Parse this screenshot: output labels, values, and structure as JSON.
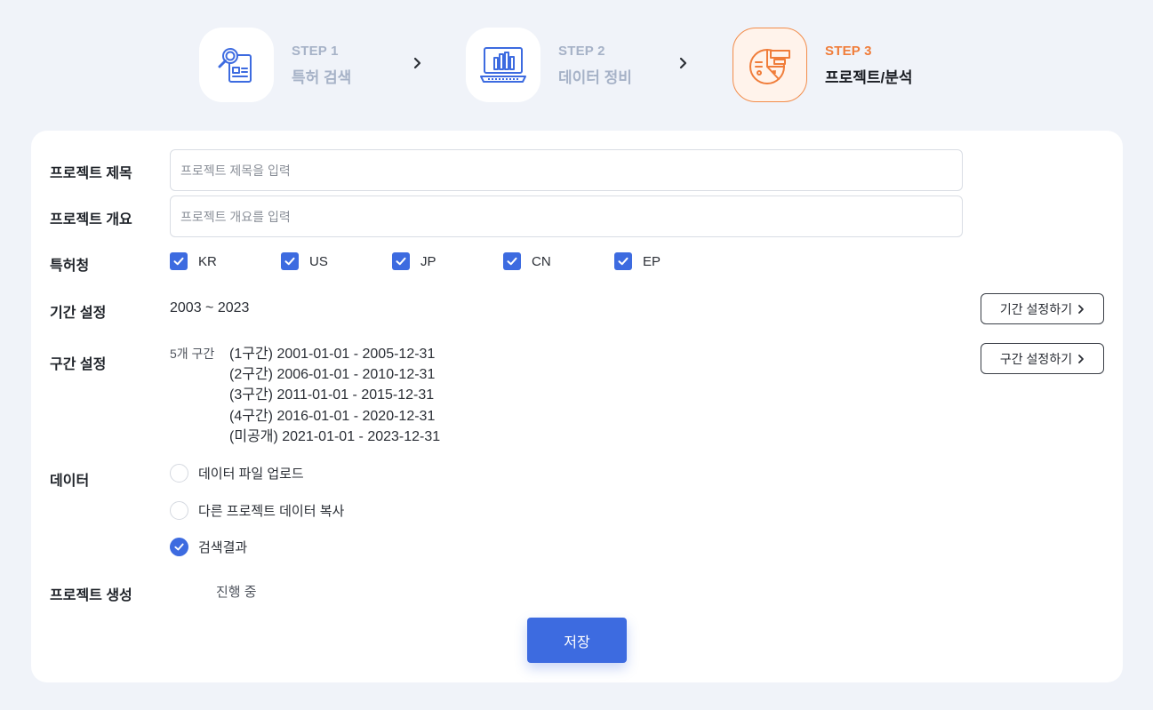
{
  "steps": [
    {
      "num": "STEP 1",
      "name": "특허 검색",
      "icon": "patent-search-icon",
      "active": false
    },
    {
      "num": "STEP 2",
      "name": "데이터 정비",
      "icon": "data-chart-monitor-icon",
      "active": false
    },
    {
      "num": "STEP 3",
      "name": "프로젝트/분석",
      "icon": "pie-chart-analysis-icon",
      "active": true
    }
  ],
  "form": {
    "title": {
      "label": "프로젝트 제목",
      "placeholder": "프로젝트 제목을 입력",
      "value": ""
    },
    "summary": {
      "label": "프로젝트 개요",
      "placeholder": "프로젝트 개요를 입력",
      "value": ""
    },
    "offices": {
      "label": "특허청",
      "items": [
        {
          "label": "KR",
          "checked": true
        },
        {
          "label": "US",
          "checked": true
        },
        {
          "label": "JP",
          "checked": true
        },
        {
          "label": "CN",
          "checked": true
        },
        {
          "label": "EP",
          "checked": true
        }
      ]
    },
    "period": {
      "label": "기간 설정",
      "value": "2003 ~ 2023",
      "button": "기간 설정하기"
    },
    "sections": {
      "label": "구간 설정",
      "count": "5개 구간",
      "items": [
        "(1구간) 2001-01-01 - 2005-12-31",
        "(2구간) 2006-01-01 - 2010-12-31",
        "(3구간) 2011-01-01 - 2015-12-31",
        "(4구간) 2016-01-01 - 2020-12-31",
        "(미공개) 2021-01-01 - 2023-12-31"
      ],
      "button": "구간 설정하기"
    },
    "data": {
      "label": "데이터",
      "options": [
        {
          "label": "데이터 파일 업로드",
          "checked": false
        },
        {
          "label": "다른 프로젝트 데이터 복사",
          "checked": false
        },
        {
          "label": "검색결과",
          "checked": true
        }
      ]
    },
    "create": {
      "label": "프로젝트 생성",
      "status": "진행 중"
    },
    "save": "저장"
  },
  "colors": {
    "primary": "#3d6be0",
    "active_step": "#f07d3a",
    "inactive_step": "#a6b2c7",
    "background": "#f0f3f9"
  }
}
